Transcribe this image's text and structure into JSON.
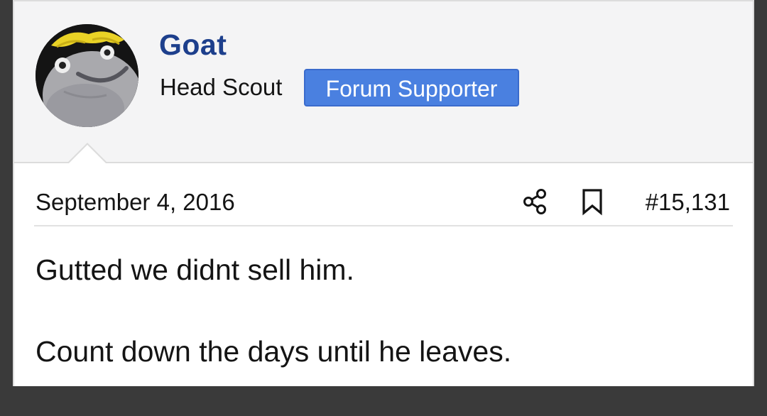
{
  "post": {
    "author": {
      "username": "Goat",
      "user_title": "Head Scout",
      "badge": "Forum Supporter",
      "avatar_icon": "sock-puppet-avatar"
    },
    "date": "September 4, 2016",
    "actions": {
      "share_icon": "share-icon",
      "bookmark_icon": "bookmark-icon"
    },
    "number": "#15,131",
    "body": [
      "Gutted we didnt sell him.",
      "Count down the days until he leaves."
    ]
  },
  "colors": {
    "username": "#1d3f8c",
    "badge_bg": "#4a80e0",
    "user_block_bg": "#f4f4f5"
  }
}
